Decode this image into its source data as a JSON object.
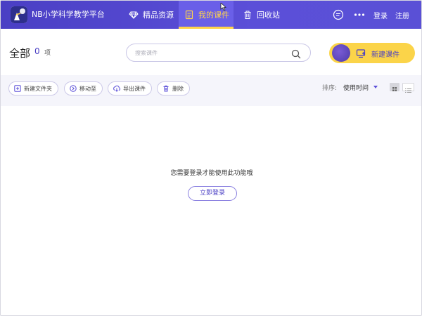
{
  "app": {
    "title": "NB小学科学教学平台"
  },
  "nav": {
    "items": [
      {
        "label": "精品资源",
        "icon": "diamond-icon"
      },
      {
        "label": "我的课件",
        "icon": "courseware-icon",
        "active": true
      },
      {
        "label": "回收站",
        "icon": "trash-icon"
      }
    ]
  },
  "top_right": {
    "login": "登录",
    "register": "注册",
    "chat_icon": "chat-icon",
    "more_icon": "more-icon"
  },
  "header": {
    "title": "全部",
    "count": "0",
    "count_unit": "项",
    "search_placeholder": "搜索课件",
    "new_course_label": "新建课件"
  },
  "toolbar": {
    "buttons": [
      {
        "label": "新建文件夹",
        "icon": "new-folder-icon"
      },
      {
        "label": "移动至",
        "icon": "move-icon"
      },
      {
        "label": "导出课件",
        "icon": "export-icon"
      },
      {
        "label": "删除",
        "icon": "trash-icon"
      }
    ],
    "sort_label": "排序:",
    "sort_value": "使用时间"
  },
  "empty": {
    "message": "您需要登录才能使用此功能哦",
    "login_button": "立即登录"
  },
  "colors": {
    "brand": "#4a3fc4",
    "accent": "#fbd449",
    "active_tab_text": "#ffd34a"
  }
}
